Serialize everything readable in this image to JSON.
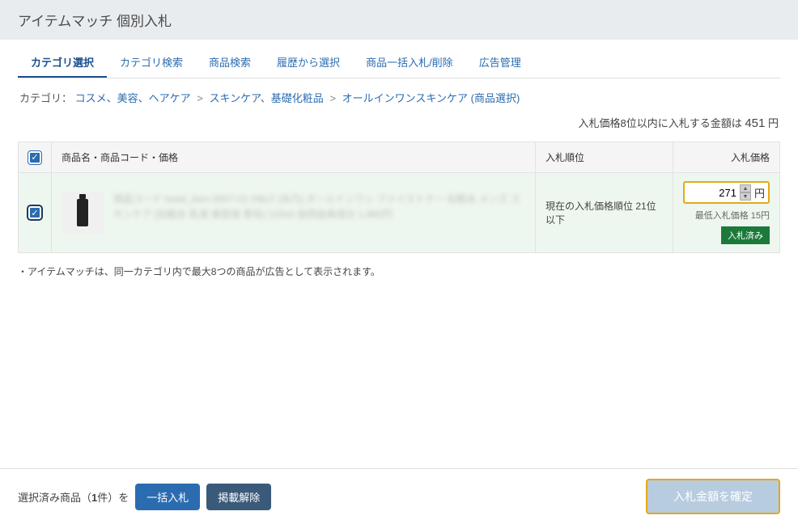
{
  "page_title": "アイテムマッチ 個別入札",
  "tabs": [
    {
      "label": "カテゴリ選択",
      "active": true
    },
    {
      "label": "カテゴリ検索"
    },
    {
      "label": "商品検索"
    },
    {
      "label": "履歴から選択"
    },
    {
      "label": "商品一括入札/削除"
    },
    {
      "label": "広告管理"
    }
  ],
  "breadcrumb": {
    "prefix": "カテゴリ：",
    "items": [
      "コスメ、美容、ヘアケア",
      "スキンケア、基礎化粧品"
    ],
    "current": "オールインワンスキンケア",
    "suffix": "(商品選択)"
  },
  "bid_note": {
    "text_prefix": "入札価格8位以内に入札する金額は",
    "amount": "451",
    "unit": "円"
  },
  "table": {
    "headers": {
      "name": "商品名・商品コード・価格",
      "rank": "入札順位",
      "price": "入札価格"
    },
    "rows": [
      {
        "rank_text": "現在の入札価格順位 21位以下",
        "price_value": "271",
        "price_unit": "円",
        "min_bid": "最低入札価格 15円",
        "badge": "入札済み",
        "blurred_text": "商品コード head_item 0007-01\nH&LF [水乃] オールインワン ファイストナー 化粧水 メンズ スキンケア [化粧水 乳液 美容液 育毛] 120ml 自然由来成分\n1,860円"
      }
    ]
  },
  "footnote": "・アイテムマッチは、同一カテゴリ内で最大8つの商品が広告として表示されます。",
  "bottom_bar": {
    "selected_prefix": "選択済み商品（",
    "selected_count": "1",
    "selected_suffix": "件）を",
    "bulk_bid": "一括入札",
    "remove": "掲載解除",
    "confirm": "入札金額を確定"
  }
}
